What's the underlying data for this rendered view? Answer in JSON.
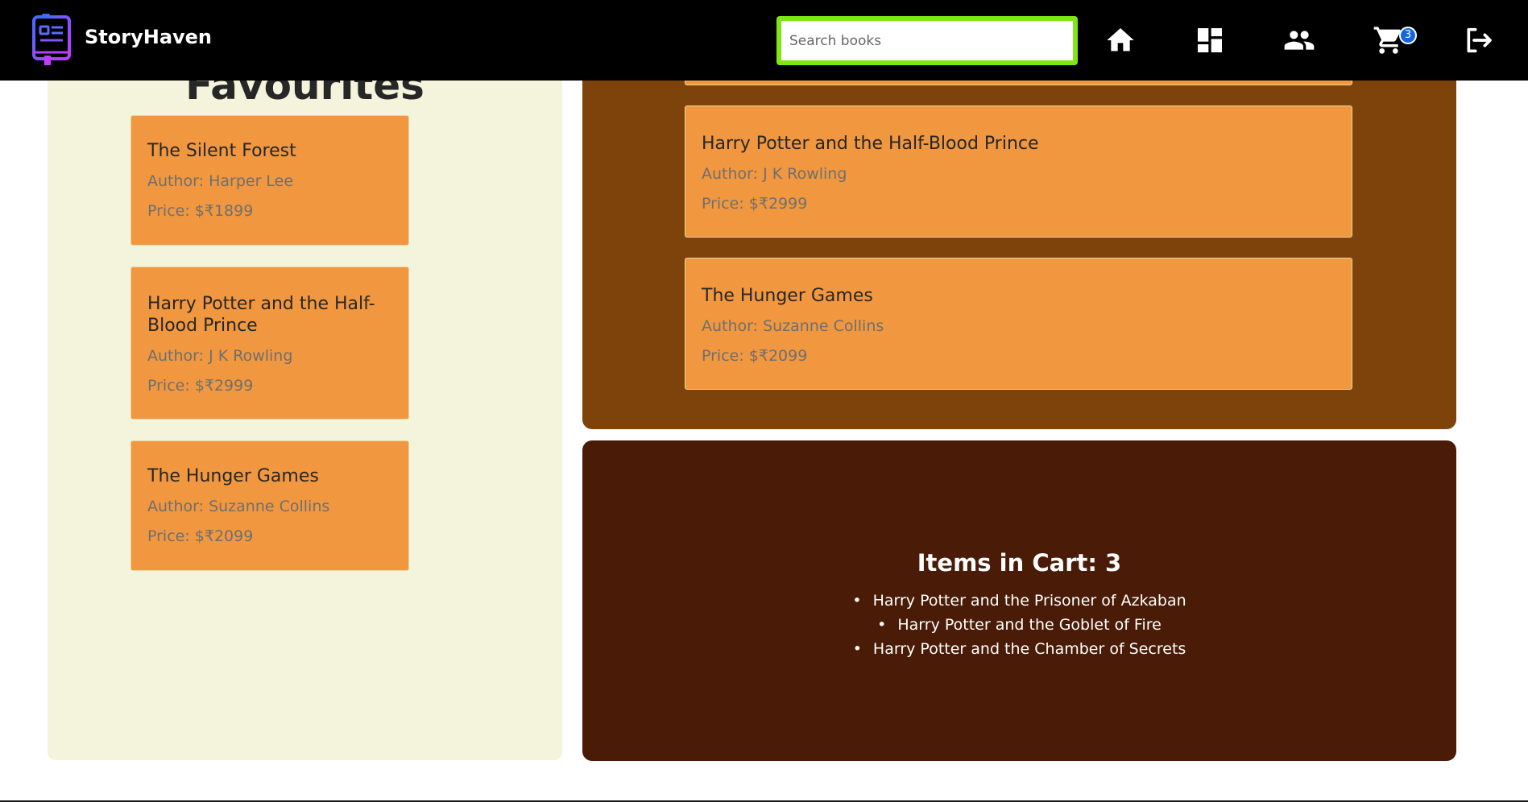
{
  "navbar": {
    "brand": "StoryHaven",
    "search": {
      "placeholder": "Search books",
      "value": ""
    },
    "icons": [
      "book-logo-icon",
      "home-icon",
      "dashboard-icon",
      "users-icon",
      "cart-icon",
      "logout-icon"
    ],
    "cart_badge": "3",
    "colors": {
      "background": "#000000",
      "search_border": "#7fe516",
      "badge": "#1565e0"
    }
  },
  "favourites": {
    "heading": "Favourites",
    "books": [
      {
        "title": "The Silent Forest",
        "author": "Author: Harper Lee",
        "price": "Price: $₹1899"
      },
      {
        "title": "Harry Potter and the Half-Blood Prince",
        "author": "Author: J K Rowling",
        "price": "Price: $₹2999"
      },
      {
        "title": "The Hunger Games",
        "author": "Author: Suzanne Collins",
        "price": "Price: $₹2099"
      }
    ]
  },
  "books_panel": {
    "books": [
      {
        "title": "Harry Potter and the Half-Blood Prince",
        "author": "Author: J K Rowling",
        "price": "Price: $₹2999"
      },
      {
        "title": "The Hunger Games",
        "author": "Author: Suzanne Collins",
        "price": "Price: $₹2099"
      }
    ]
  },
  "cart": {
    "title": "Items in Cart: 3",
    "items": [
      "Harry Potter and the Prisoner of Azkaban",
      "Harry Potter and the Goblet of Fire",
      "Harry Potter and the Chamber of Secrets"
    ]
  },
  "colors": {
    "favourites_panel": "#f4f3dc",
    "book_card": "#f0973f",
    "books_panel": "#7d430a",
    "cart_panel": "#4a1c07"
  }
}
